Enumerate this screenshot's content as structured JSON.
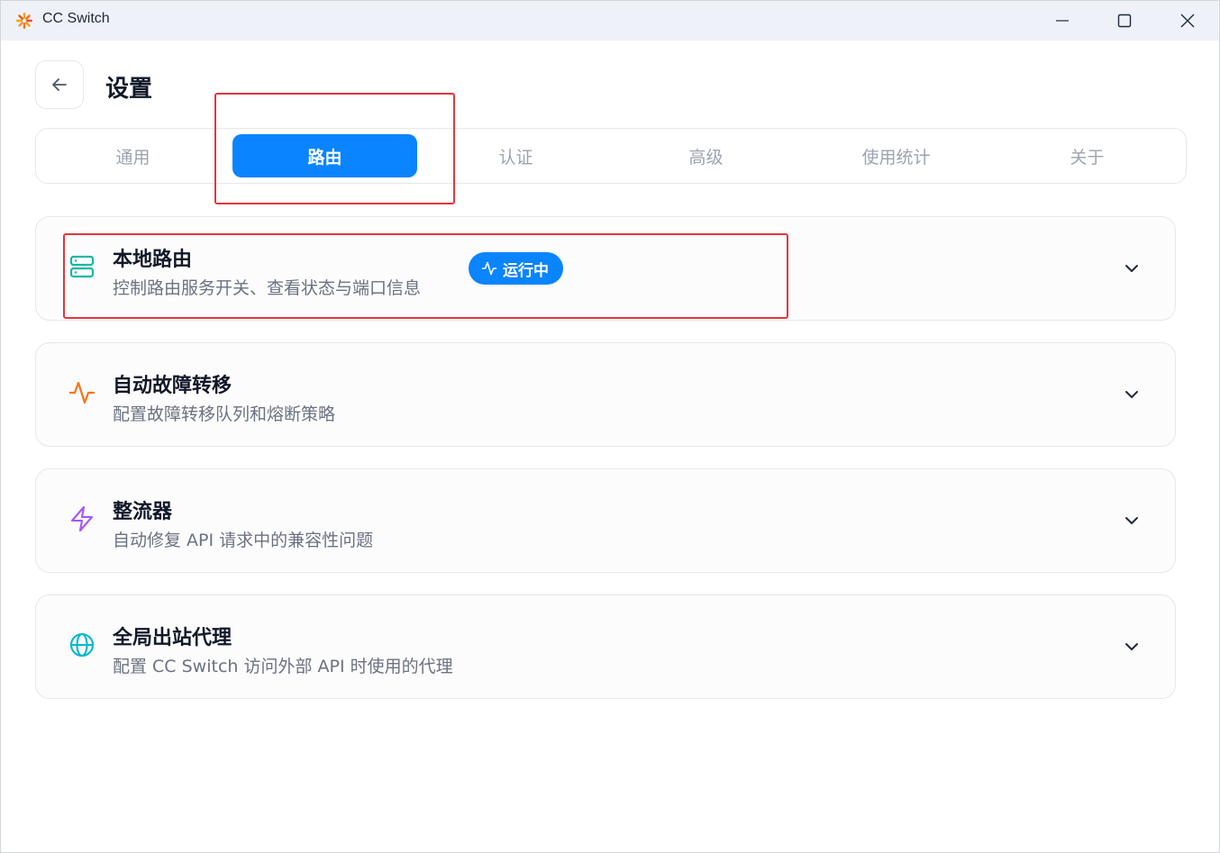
{
  "window": {
    "title": "CC Switch"
  },
  "header": {
    "title": "设置"
  },
  "tabs": [
    {
      "label": "通用",
      "active": false
    },
    {
      "label": "路由",
      "active": true
    },
    {
      "label": "认证",
      "active": false
    },
    {
      "label": "高级",
      "active": false
    },
    {
      "label": "使用统计",
      "active": false
    },
    {
      "label": "关于",
      "active": false
    }
  ],
  "cards": [
    {
      "title": "本地路由",
      "description": "控制路由服务开关、查看状态与端口信息",
      "icon": "server-icon",
      "icon_color": "#14b8a6",
      "badge": "运行中"
    },
    {
      "title": "自动故障转移",
      "description": "配置故障转移队列和熔断策略",
      "icon": "activity-icon",
      "icon_color": "#f97316"
    },
    {
      "title": "整流器",
      "description": "自动修复 API 请求中的兼容性问题",
      "icon": "zap-icon",
      "icon_color": "#a855f7"
    },
    {
      "title": "全局出站代理",
      "description": "配置 CC Switch 访问外部 API 时使用的代理",
      "icon": "globe-icon",
      "icon_color": "#06b6d4"
    }
  ],
  "colors": {
    "accent": "#0a84ff",
    "annotation": "#e5343d"
  }
}
